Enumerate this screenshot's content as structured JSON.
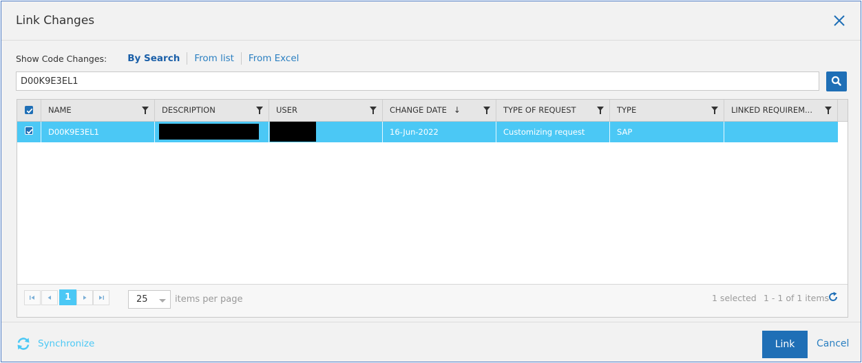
{
  "dialog": {
    "title": "Link Changes"
  },
  "show": {
    "label": "Show Code Changes:",
    "modes": [
      "By Search",
      "From list",
      "From Excel"
    ],
    "active": "By Search"
  },
  "search": {
    "value": "D00K9E3EL1"
  },
  "grid": {
    "columns": [
      "NAME",
      "DESCRIPTION",
      "USER",
      "CHANGE DATE",
      "TYPE OF REQUEST",
      "TYPE",
      "LINKED REQUIREM..."
    ],
    "rows": [
      {
        "name": "D00K9E3EL1",
        "description": "",
        "user": "",
        "change_date": "16-Jun-2022",
        "type_of_request": "Customizing request",
        "type": "SAP",
        "linked_requirements": ""
      }
    ],
    "sort_indicator": "↓"
  },
  "pager": {
    "current_page": "1",
    "page_size": "25",
    "page_size_label": "items per page",
    "selected_info": "1 selected",
    "range_info": "1 - 1 of 1 items"
  },
  "footer": {
    "sync_label": "Synchronize",
    "link_label": "Link",
    "cancel_label": "Cancel"
  },
  "colors": {
    "accent": "#1f6fb6",
    "row_selected": "#4bc8f5",
    "link": "#2a7fc1"
  }
}
